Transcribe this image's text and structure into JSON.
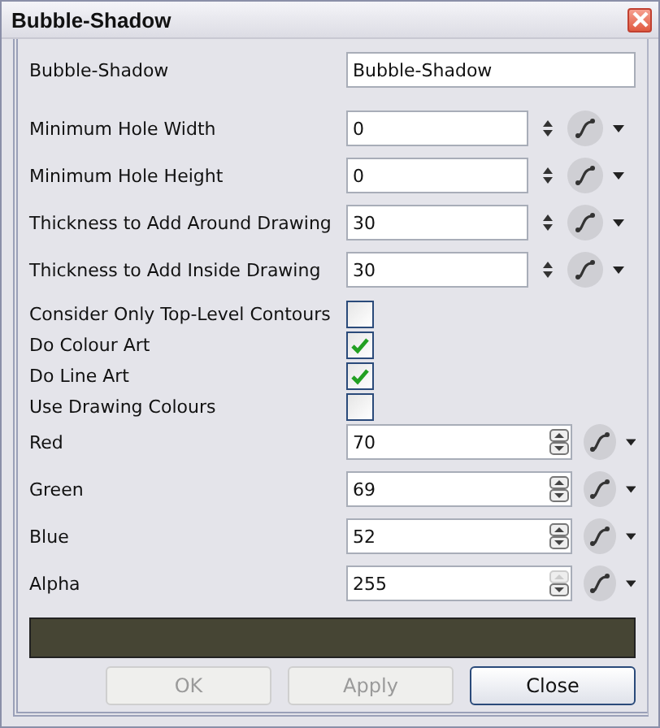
{
  "window": {
    "title": "Bubble-Shadow"
  },
  "fields": [
    {
      "kind": "text",
      "label": "Bubble-Shadow",
      "value": "Bubble-Shadow"
    },
    {
      "kind": "number",
      "label": "Minimum Hole Width",
      "value": "0"
    },
    {
      "kind": "number",
      "label": "Minimum Hole Height",
      "value": "0"
    },
    {
      "kind": "number",
      "label": "Thickness to Add Around Drawing",
      "value": "30"
    },
    {
      "kind": "number",
      "label": "Thickness to Add Inside Drawing",
      "value": "30"
    },
    {
      "kind": "checkbox",
      "label": "Consider Only Top-Level Contours",
      "checked": false
    },
    {
      "kind": "checkbox",
      "label": "Do Colour Art",
      "checked": true
    },
    {
      "kind": "checkbox",
      "label": "Do Line Art",
      "checked": true
    },
    {
      "kind": "checkbox",
      "label": "Use Drawing Colours",
      "checked": false
    },
    {
      "kind": "spin",
      "label": "Red",
      "value": "70",
      "up_disabled": false
    },
    {
      "kind": "spin",
      "label": "Green",
      "value": "69",
      "up_disabled": false
    },
    {
      "kind": "spin",
      "label": "Blue",
      "value": "52",
      "up_disabled": false
    },
    {
      "kind": "spin",
      "label": "Alpha",
      "value": "255",
      "up_disabled": true
    }
  ],
  "swatch": {
    "color": "#464534"
  },
  "buttons": [
    {
      "label": "OK",
      "disabled": true,
      "default": false
    },
    {
      "label": "Apply",
      "disabled": true,
      "default": false
    },
    {
      "label": "Close",
      "disabled": false,
      "default": true
    }
  ]
}
